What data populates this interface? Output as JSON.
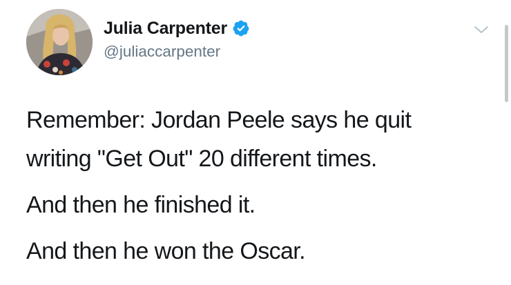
{
  "tweet": {
    "author": {
      "display_name": "Julia Carpenter",
      "handle": "@juliaccarpenter",
      "verified": true
    },
    "text_lines": [
      "Remember: Jordan Peele says he quit",
      "writing \"Get Out\" 20 different times.",
      "And then he finished it.",
      "And then he won the Oscar."
    ]
  },
  "icons": {
    "verified": "verified-badge-icon",
    "more": "chevron-down-icon"
  },
  "colors": {
    "text": "#14171a",
    "secondary_text": "#657786",
    "verified_blue": "#1da1f2",
    "background": "#ffffff"
  }
}
